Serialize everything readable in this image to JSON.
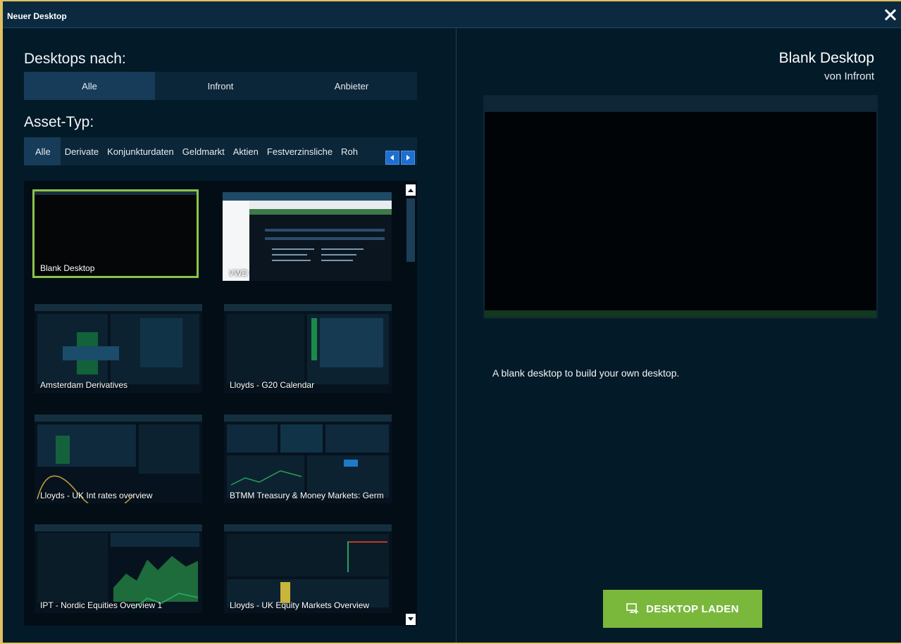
{
  "window": {
    "title": "Neuer Desktop"
  },
  "filters": {
    "desktops_heading": "Desktops nach:",
    "desktops_options": [
      "Alle",
      "Infront",
      "Anbieter"
    ],
    "asset_heading": "Asset-Typ:",
    "asset_tabs": [
      "Alle",
      "Derivate",
      "Konjunkturdaten",
      "Geldmarkt",
      "Aktien",
      "Festverzinsliche",
      "Roh"
    ]
  },
  "desktops": [
    {
      "name": "Blank Desktop",
      "selected": true
    },
    {
      "name": "VWD",
      "selected": false
    },
    {
      "name": "Amsterdam Derivatives",
      "selected": false
    },
    {
      "name": "Lloyds - G20 Calendar",
      "selected": false
    },
    {
      "name": "Lloyds - UK  Int rates overview",
      "selected": false
    },
    {
      "name": "BTMM Treasury & Money Markets: Germ",
      "selected": false
    },
    {
      "name": "IPT - Nordic Equities Overview 1",
      "selected": false
    },
    {
      "name": "Lloyds - UK Equity Markets Overview",
      "selected": false
    }
  ],
  "detail": {
    "title": "Blank Desktop",
    "provider": "von Infront",
    "description": "A blank desktop to build your own desktop.",
    "load_button": "DESKTOP LADEN"
  },
  "colors": {
    "accent_green": "#7ab83c",
    "selected_border": "#8bc34a",
    "window_border": "#e0c060"
  }
}
